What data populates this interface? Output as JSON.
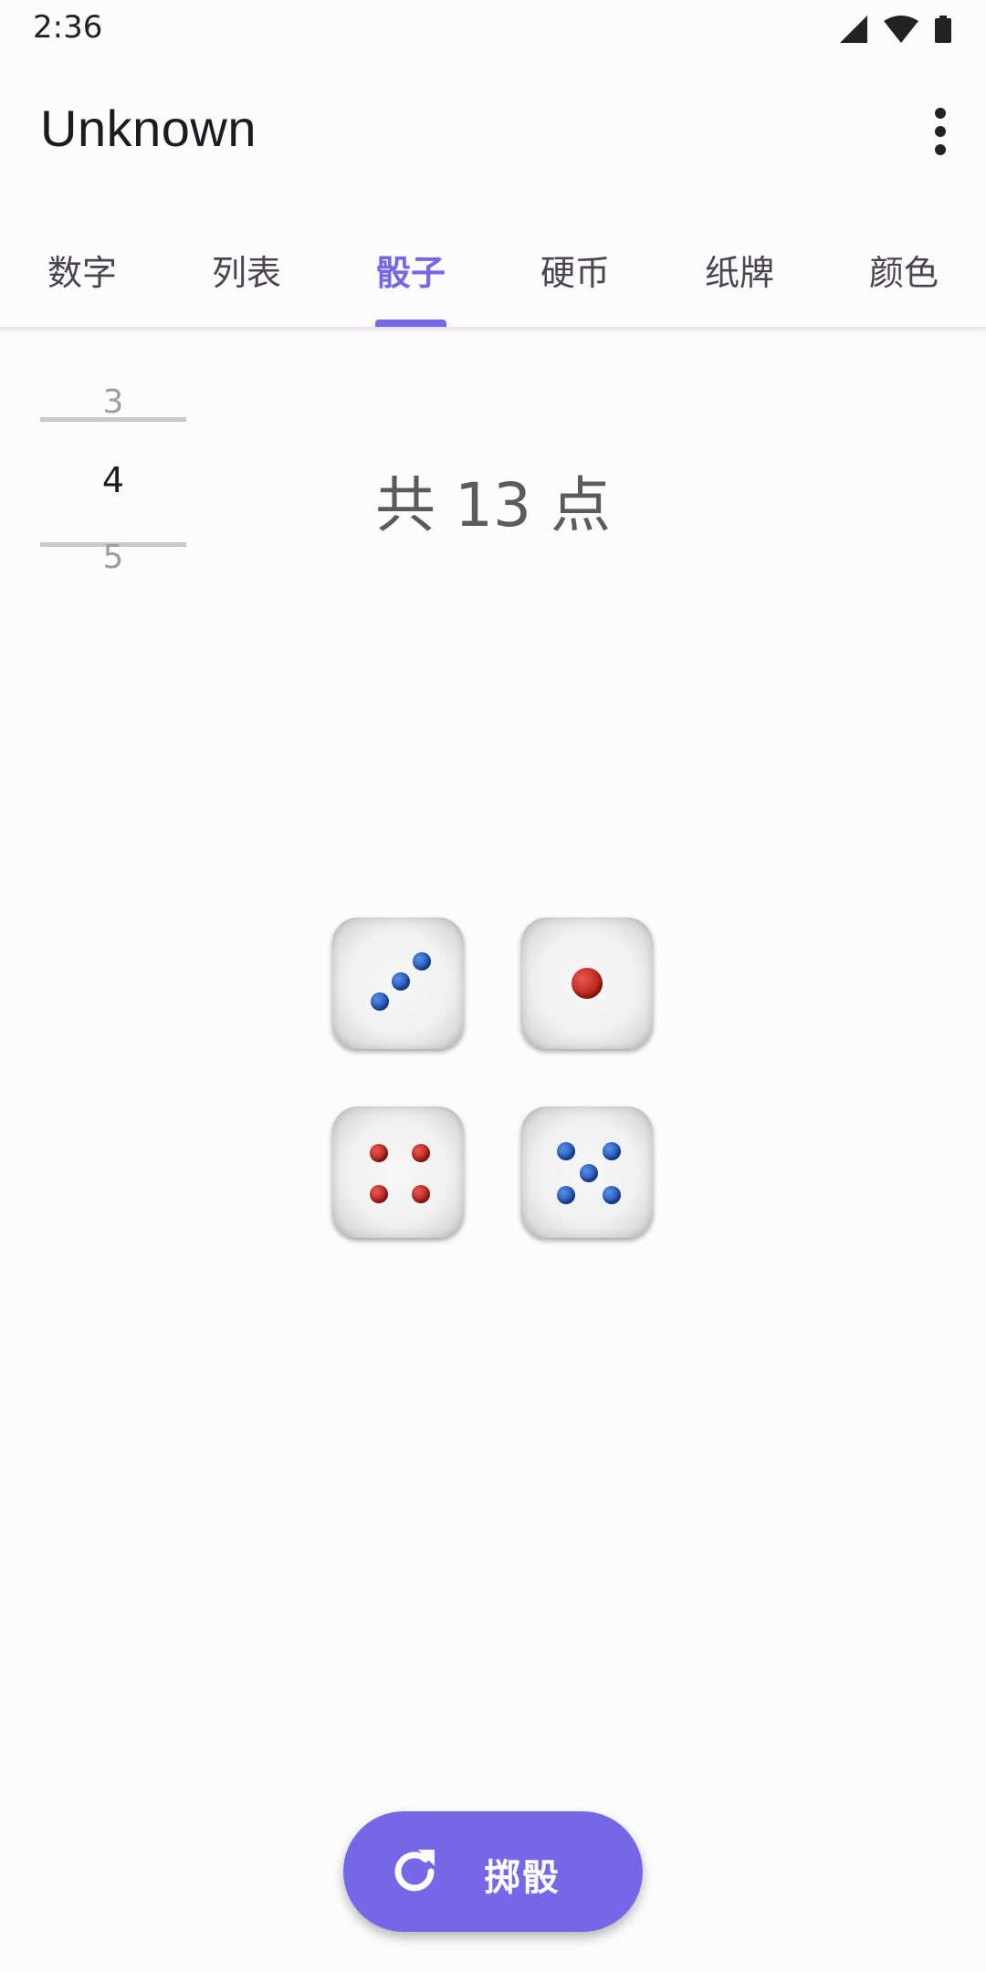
{
  "status_bar": {
    "time": "2:36",
    "icons": [
      "signal-icon",
      "wifi-icon",
      "battery-icon"
    ]
  },
  "app_bar": {
    "title": "Unknown",
    "menu_icon": "more-vert-icon"
  },
  "tabs": [
    {
      "label": "数字",
      "active": false
    },
    {
      "label": "列表",
      "active": false
    },
    {
      "label": "骰子",
      "active": true
    },
    {
      "label": "硬币",
      "active": false
    },
    {
      "label": "纸牌",
      "active": false
    },
    {
      "label": "颜色",
      "active": false
    }
  ],
  "dice_count_picker": {
    "previous": "3",
    "current": "4",
    "next": "5"
  },
  "total": "共 13 点",
  "dice": [
    {
      "value": 3,
      "pip_color": "blue"
    },
    {
      "value": 1,
      "pip_color": "red"
    },
    {
      "value": 4,
      "pip_color": "red"
    },
    {
      "value": 5,
      "pip_color": "blue"
    }
  ],
  "roll_button": {
    "label": "掷骰",
    "icon": "refresh-icon"
  },
  "colors": {
    "accent": "#7568e8",
    "pip_blue": "#1b4fb5",
    "pip_red": "#b21d16"
  }
}
